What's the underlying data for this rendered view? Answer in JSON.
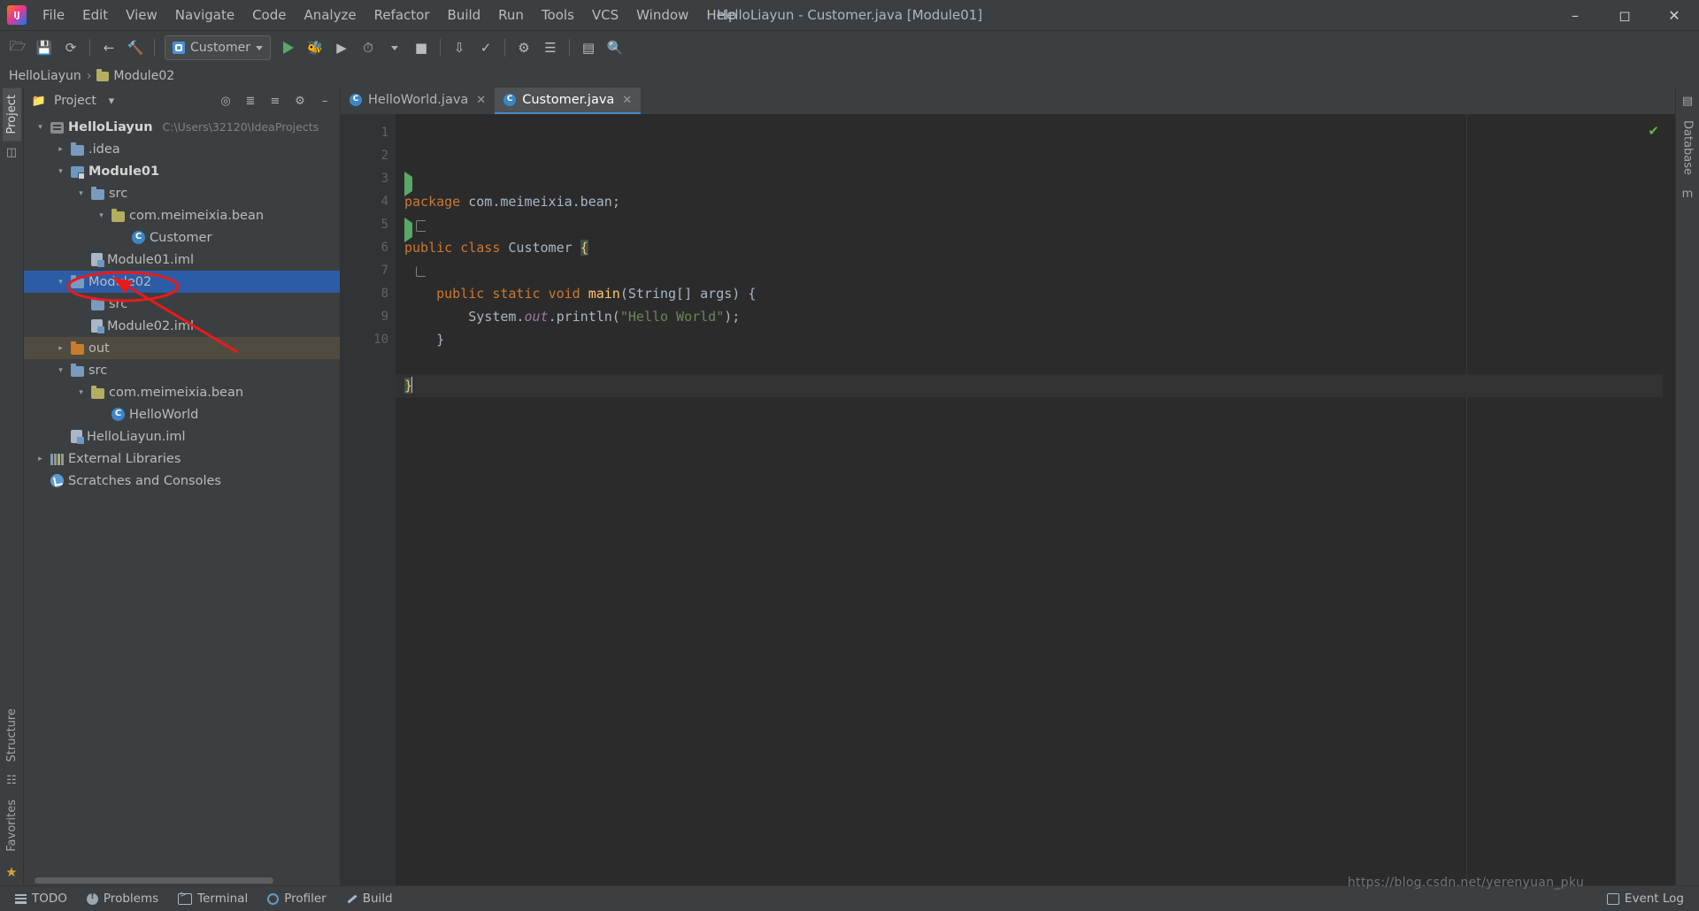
{
  "window": {
    "title": "HelloLiayun - Customer.java [Module01]",
    "logo_icon": "intellij-idea-logo",
    "minimize_icon": "minimize-icon",
    "maximize_icon": "maximize-icon",
    "close_icon": "close-icon"
  },
  "menubar": {
    "items": [
      "File",
      "Edit",
      "View",
      "Navigate",
      "Code",
      "Analyze",
      "Refactor",
      "Build",
      "Run",
      "Tools",
      "VCS",
      "Window",
      "Help"
    ]
  },
  "toolbar": {
    "open_icon": "open-folder-icon",
    "save_icon": "save-all-icon",
    "sync_icon": "synchronize-icon",
    "back_icon": "navigate-back-icon",
    "build_icon": "build-hammer-icon",
    "run_config": "Customer",
    "run_icon": "run-icon",
    "debug_icon": "debug-icon",
    "coverage_icon": "run-with-coverage-icon",
    "profile_icon": "profile-icon",
    "stop_icon": "stop-icon",
    "update_icon": "update-project-icon",
    "commit_icon": "commit-icon",
    "settings_icon": "settings-gear-icon",
    "structure_icon": "structure-icon",
    "layout_icon": "layout-icon",
    "search_icon": "search-everywhere-icon"
  },
  "breadcrumb": {
    "project": "HelloLiayun",
    "module": "Module02",
    "separator": "›"
  },
  "left_rail": {
    "project_tab": "Project",
    "structure_tab": "Structure",
    "favorites_tab": "Favorites",
    "bookmark_icon": "star-icon"
  },
  "right_rail": {
    "database_tab": "Database",
    "maven_icon": "maven-icon"
  },
  "project_panel": {
    "title": "Project",
    "title_caret": "▾",
    "locate_icon": "select-opened-file-icon",
    "collapse_icon": "expand-all-icon",
    "expand_icon": "collapse-all-icon",
    "settings_icon": "panel-settings-icon",
    "hide_icon": "hide-panel-icon",
    "tree": [
      {
        "label": "HelloLiayun",
        "path": "C:\\Users\\32120\\IdeaProjects",
        "indent": 0,
        "arrow": "expanded",
        "icon": "project-icon",
        "bold": true,
        "state": "normal"
      },
      {
        "label": ".idea",
        "path": "",
        "indent": 1,
        "arrow": "collapsed",
        "icon": "folder-blue-icon",
        "bold": false,
        "state": "normal"
      },
      {
        "label": "Module01",
        "path": "",
        "indent": 1,
        "arrow": "expanded",
        "icon": "module-icon",
        "bold": true,
        "state": "normal"
      },
      {
        "label": "src",
        "path": "",
        "indent": 2,
        "arrow": "expanded",
        "icon": "folder-blue-icon",
        "bold": false,
        "state": "normal"
      },
      {
        "label": "com.meimeixia.bean",
        "path": "",
        "indent": 3,
        "arrow": "expanded",
        "icon": "package-icon",
        "bold": false,
        "state": "normal"
      },
      {
        "label": "Customer",
        "path": "",
        "indent": 4,
        "arrow": "none",
        "icon": "java-class-icon",
        "bold": false,
        "state": "normal"
      },
      {
        "label": "Module01.iml",
        "path": "",
        "indent": 2,
        "arrow": "none",
        "icon": "iml-file-icon",
        "bold": false,
        "state": "normal"
      },
      {
        "label": "Module02",
        "path": "",
        "indent": 1,
        "arrow": "expanded",
        "icon": "folder-blue-icon",
        "bold": false,
        "state": "selected"
      },
      {
        "label": "src",
        "path": "",
        "indent": 2,
        "arrow": "none",
        "icon": "folder-blue-icon",
        "bold": false,
        "state": "normal"
      },
      {
        "label": "Module02.iml",
        "path": "",
        "indent": 2,
        "arrow": "none",
        "icon": "iml-file-icon",
        "bold": false,
        "state": "normal"
      },
      {
        "label": "out",
        "path": "",
        "indent": 1,
        "arrow": "collapsed",
        "icon": "folder-orange-icon",
        "bold": false,
        "state": "highlight"
      },
      {
        "label": "src",
        "path": "",
        "indent": 1,
        "arrow": "expanded",
        "icon": "folder-blue-icon",
        "bold": false,
        "state": "normal"
      },
      {
        "label": "com.meimeixia.bean",
        "path": "",
        "indent": 2,
        "arrow": "expanded",
        "icon": "package-icon",
        "bold": false,
        "state": "normal"
      },
      {
        "label": "HelloWorld",
        "path": "",
        "indent": 3,
        "arrow": "none",
        "icon": "java-class-icon",
        "bold": false,
        "state": "normal"
      },
      {
        "label": "HelloLiayun.iml",
        "path": "",
        "indent": 1,
        "arrow": "none",
        "icon": "iml-file-icon",
        "bold": false,
        "state": "normal"
      },
      {
        "label": "External Libraries",
        "path": "",
        "indent": 0,
        "arrow": "collapsed",
        "icon": "libraries-icon",
        "bold": false,
        "state": "normal"
      },
      {
        "label": "Scratches and Consoles",
        "path": "",
        "indent": 0,
        "arrow": "none",
        "icon": "scratches-icon",
        "bold": false,
        "state": "normal"
      }
    ]
  },
  "editor": {
    "tabs": [
      {
        "label": "HelloWorld.java",
        "icon": "java-class-icon",
        "close_icon": "close-tab-icon",
        "active": false
      },
      {
        "label": "Customer.java",
        "icon": "java-class-icon",
        "close_icon": "close-tab-icon",
        "active": true
      }
    ],
    "line_numbers": [
      "1",
      "2",
      "3",
      "4",
      "5",
      "6",
      "7",
      "8",
      "9",
      "10"
    ],
    "inspection_status": "✔",
    "code_lines": [
      {
        "n": 1,
        "tokens": [
          {
            "t": "package",
            "c": "kw"
          },
          {
            "t": " com.meimeixia.bean",
            "c": "plain"
          },
          {
            "t": ";",
            "c": "plain"
          }
        ]
      },
      {
        "n": 2,
        "tokens": []
      },
      {
        "n": 3,
        "tokens": [
          {
            "t": "public",
            "c": "kw"
          },
          {
            "t": " ",
            "c": "plain"
          },
          {
            "t": "class",
            "c": "kw"
          },
          {
            "t": " Customer ",
            "c": "plain"
          },
          {
            "t": "{",
            "c": "brace"
          }
        ]
      },
      {
        "n": 4,
        "tokens": []
      },
      {
        "n": 5,
        "tokens": [
          {
            "t": "    ",
            "c": "plain"
          },
          {
            "t": "public",
            "c": "kw"
          },
          {
            "t": " ",
            "c": "plain"
          },
          {
            "t": "static",
            "c": "kw"
          },
          {
            "t": " ",
            "c": "plain"
          },
          {
            "t": "void",
            "c": "kw"
          },
          {
            "t": " ",
            "c": "plain"
          },
          {
            "t": "main",
            "c": "fn"
          },
          {
            "t": "(String[] args) {",
            "c": "plain"
          }
        ]
      },
      {
        "n": 6,
        "tokens": [
          {
            "t": "        System.",
            "c": "plain"
          },
          {
            "t": "out",
            "c": "fld"
          },
          {
            "t": ".println(",
            "c": "plain"
          },
          {
            "t": "\"Hello World\"",
            "c": "str"
          },
          {
            "t": ");",
            "c": "plain"
          }
        ]
      },
      {
        "n": 7,
        "tokens": [
          {
            "t": "    }",
            "c": "plain"
          }
        ]
      },
      {
        "n": 8,
        "tokens": []
      },
      {
        "n": 9,
        "tokens": [
          {
            "t": "}",
            "c": "brace"
          }
        ]
      },
      {
        "n": 10,
        "tokens": []
      }
    ],
    "gutter_run_lines": [
      3,
      5
    ]
  },
  "statusbar": {
    "items": [
      {
        "label": "TODO",
        "icon": "todo-icon"
      },
      {
        "label": "Problems",
        "icon": "problems-icon"
      },
      {
        "label": "Terminal",
        "icon": "terminal-icon"
      },
      {
        "label": "Profiler",
        "icon": "profiler-icon"
      },
      {
        "label": "Build",
        "icon": "build-icon"
      }
    ],
    "event_log": "Event Log",
    "event_log_icon": "event-log-icon"
  },
  "watermark": "https://blog.csdn.net/yerenyuan_pku",
  "annotation": {
    "ellipse_color": "#e81b1b",
    "arrow_color": "#e81b1b"
  }
}
